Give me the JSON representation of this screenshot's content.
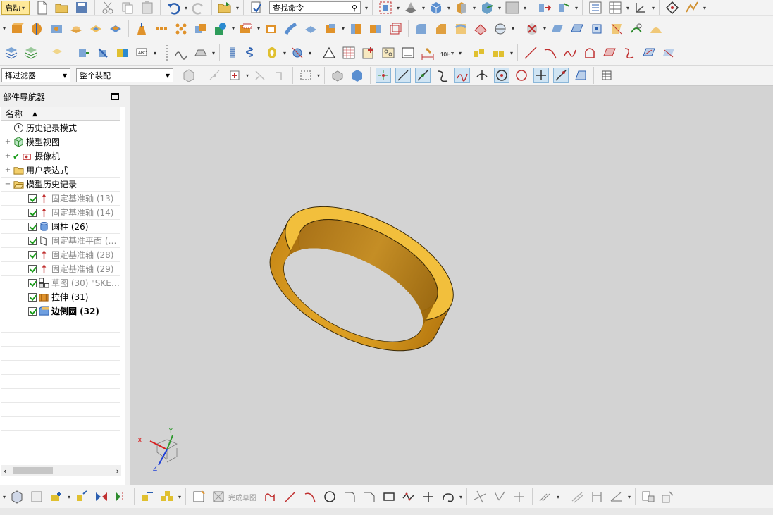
{
  "toolbar_top": {
    "start_label": "启动",
    "search_placeholder": "查找命令",
    "icons": [
      "new-file-icon",
      "open-folder-icon",
      "save-icon",
      "cut-icon",
      "copy-icon",
      "paste-icon",
      "undo-icon",
      "redo-icon"
    ]
  },
  "selection_bar": {
    "filter_label": "择过滤器",
    "scope_label": "整个装配"
  },
  "navigator": {
    "title": "部件导航器",
    "column_header": "名称",
    "nodes": [
      {
        "label": "历史记录模式",
        "icon": "clock-icon"
      },
      {
        "label": "模型视图",
        "icon": "model-view-icon"
      },
      {
        "label": "摄像机",
        "icon": "camera-icon"
      },
      {
        "label": "用户表达式",
        "icon": "folder-icon"
      },
      {
        "label": "模型历史记录",
        "icon": "open-folder-icon"
      }
    ],
    "features": [
      {
        "label": "固定基准轴 (13)",
        "icon": "datum-axis-icon"
      },
      {
        "label": "固定基准轴 (14)",
        "icon": "datum-axis-icon"
      },
      {
        "label": "圆柱 (26)",
        "icon": "cylinder-icon"
      },
      {
        "label": "固定基准平面 (…",
        "icon": "datum-plane-icon"
      },
      {
        "label": "固定基准轴 (28)",
        "icon": "datum-axis-icon"
      },
      {
        "label": "固定基准轴 (29)",
        "icon": "datum-axis-icon"
      },
      {
        "label": "草图 (30) \"SKE…",
        "icon": "sketch-icon"
      },
      {
        "label": "拉伸 (31)",
        "icon": "extrude-icon"
      },
      {
        "label": "边倒圆 (32)",
        "icon": "edge-blend-icon"
      }
    ]
  },
  "bottom_toolbar": {
    "finish_sketch_label": "完成草图"
  },
  "triad": {
    "x_label": "X",
    "y_label": "Y",
    "z_label": "Z"
  },
  "colors": {
    "part_gold": "#e2a21f",
    "viewport_bg": "#d3d3d3",
    "axis_x": "#d81e1e",
    "axis_y": "#2f9a2f",
    "axis_z": "#1e3fd8"
  }
}
